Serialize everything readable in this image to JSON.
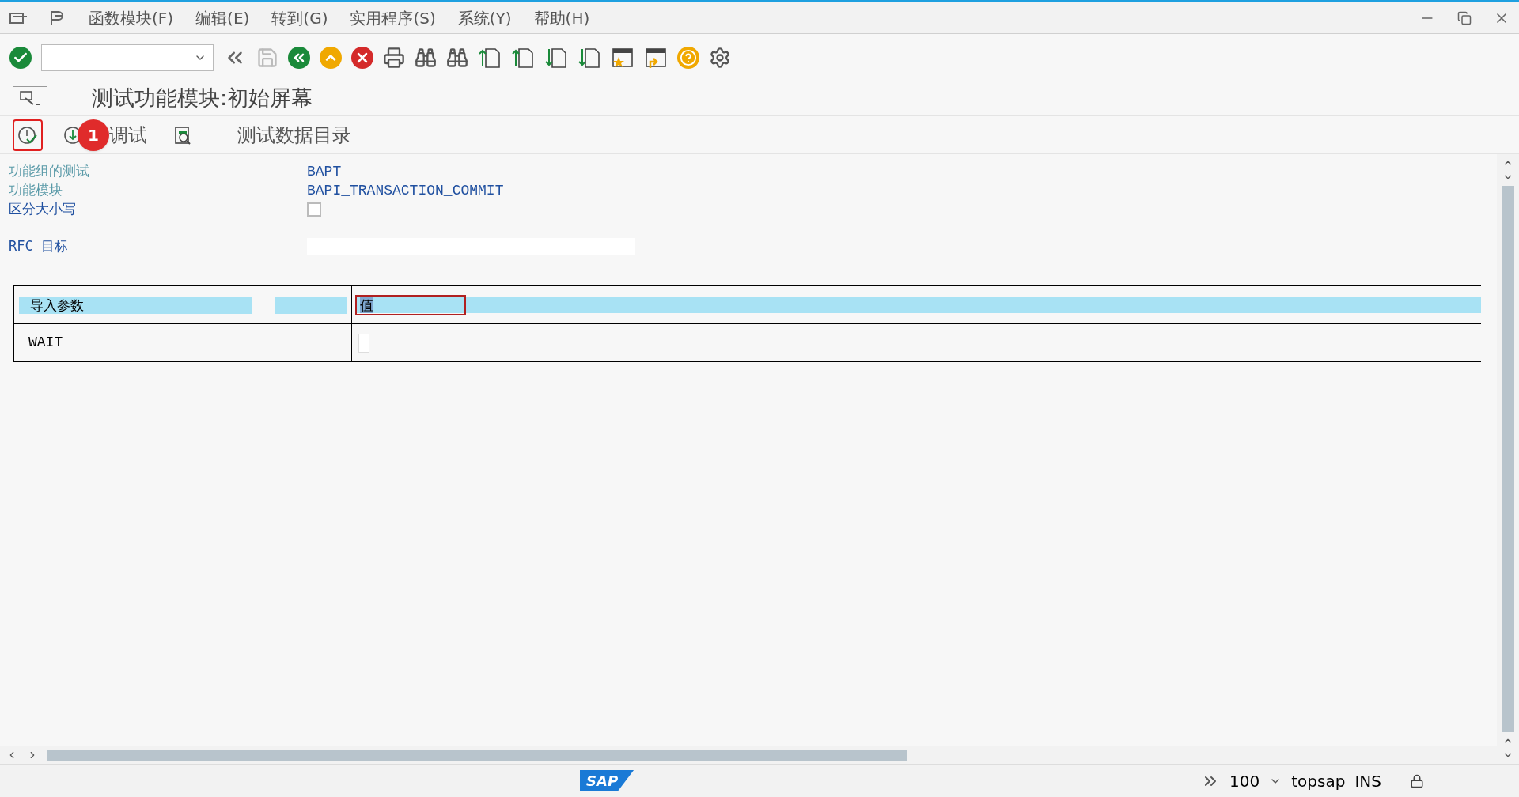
{
  "menu": [
    "函数模块(F)",
    "编辑(E)",
    "转到(G)",
    "实用程序(S)",
    "系统(Y)",
    "帮助(H)"
  ],
  "title": "测试功能模块:初始屏幕",
  "app_toolbar": [
    {
      "kind": "execute",
      "highlighted": true
    },
    {
      "kind": "debug",
      "label": "调试",
      "highlighted": false
    },
    {
      "kind": "catalog-icon",
      "highlighted": false
    },
    {
      "kind": "text",
      "label": "测试数据目录",
      "highlighted": false
    }
  ],
  "annotation_badge": "1",
  "fields": [
    {
      "label": "功能组的测试",
      "kind": "text",
      "value": "BAPT",
      "greyed": true
    },
    {
      "label": "功能模块",
      "kind": "text",
      "value": "BAPI_TRANSACTION_COMMIT",
      "greyed": true
    },
    {
      "label": "区分大小写",
      "kind": "checkbox",
      "checked": false,
      "greyed": false
    },
    {
      "label": "RFC 目标",
      "kind": "input",
      "greyed": false
    }
  ],
  "table": {
    "header": [
      "导入参数",
      "值"
    ],
    "rows": [
      {
        "name": "WAIT"
      }
    ]
  },
  "status_bar": {
    "logo_text": "SAP",
    "zoom": "100",
    "system": "topsap",
    "mode": "INS"
  }
}
